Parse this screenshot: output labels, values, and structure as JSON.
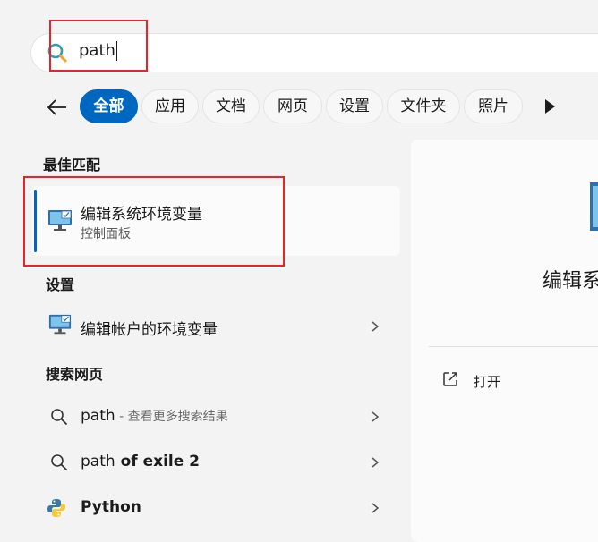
{
  "search": {
    "query": "path"
  },
  "filters": {
    "chips": [
      "全部",
      "应用",
      "文档",
      "网页",
      "设置",
      "文件夹",
      "照片"
    ],
    "active_index": 0
  },
  "best_match": {
    "heading": "最佳匹配",
    "item": {
      "title": "编辑系统环境变量",
      "subtitle": "控制面板",
      "icon": "monitor-settings-icon"
    }
  },
  "settings": {
    "heading": "设置",
    "items": [
      {
        "title": "编辑帐户的环境变量",
        "icon": "monitor-settings-icon"
      }
    ]
  },
  "web": {
    "heading": "搜索网页",
    "items": [
      {
        "prefix": "path",
        "suffix": " - 查看更多搜索结果",
        "icon": "search-icon"
      },
      {
        "prefix": "path",
        "suffix": " of exile 2",
        "icon": "search-icon"
      },
      {
        "prefix": "Python",
        "suffix": "",
        "icon": "python-icon"
      }
    ]
  },
  "preview": {
    "title": "编辑系统",
    "actions": [
      {
        "label": "打开",
        "icon": "open-external-icon"
      }
    ]
  },
  "colors": {
    "accent": "#0067c0",
    "annotation": "#e8232a"
  }
}
